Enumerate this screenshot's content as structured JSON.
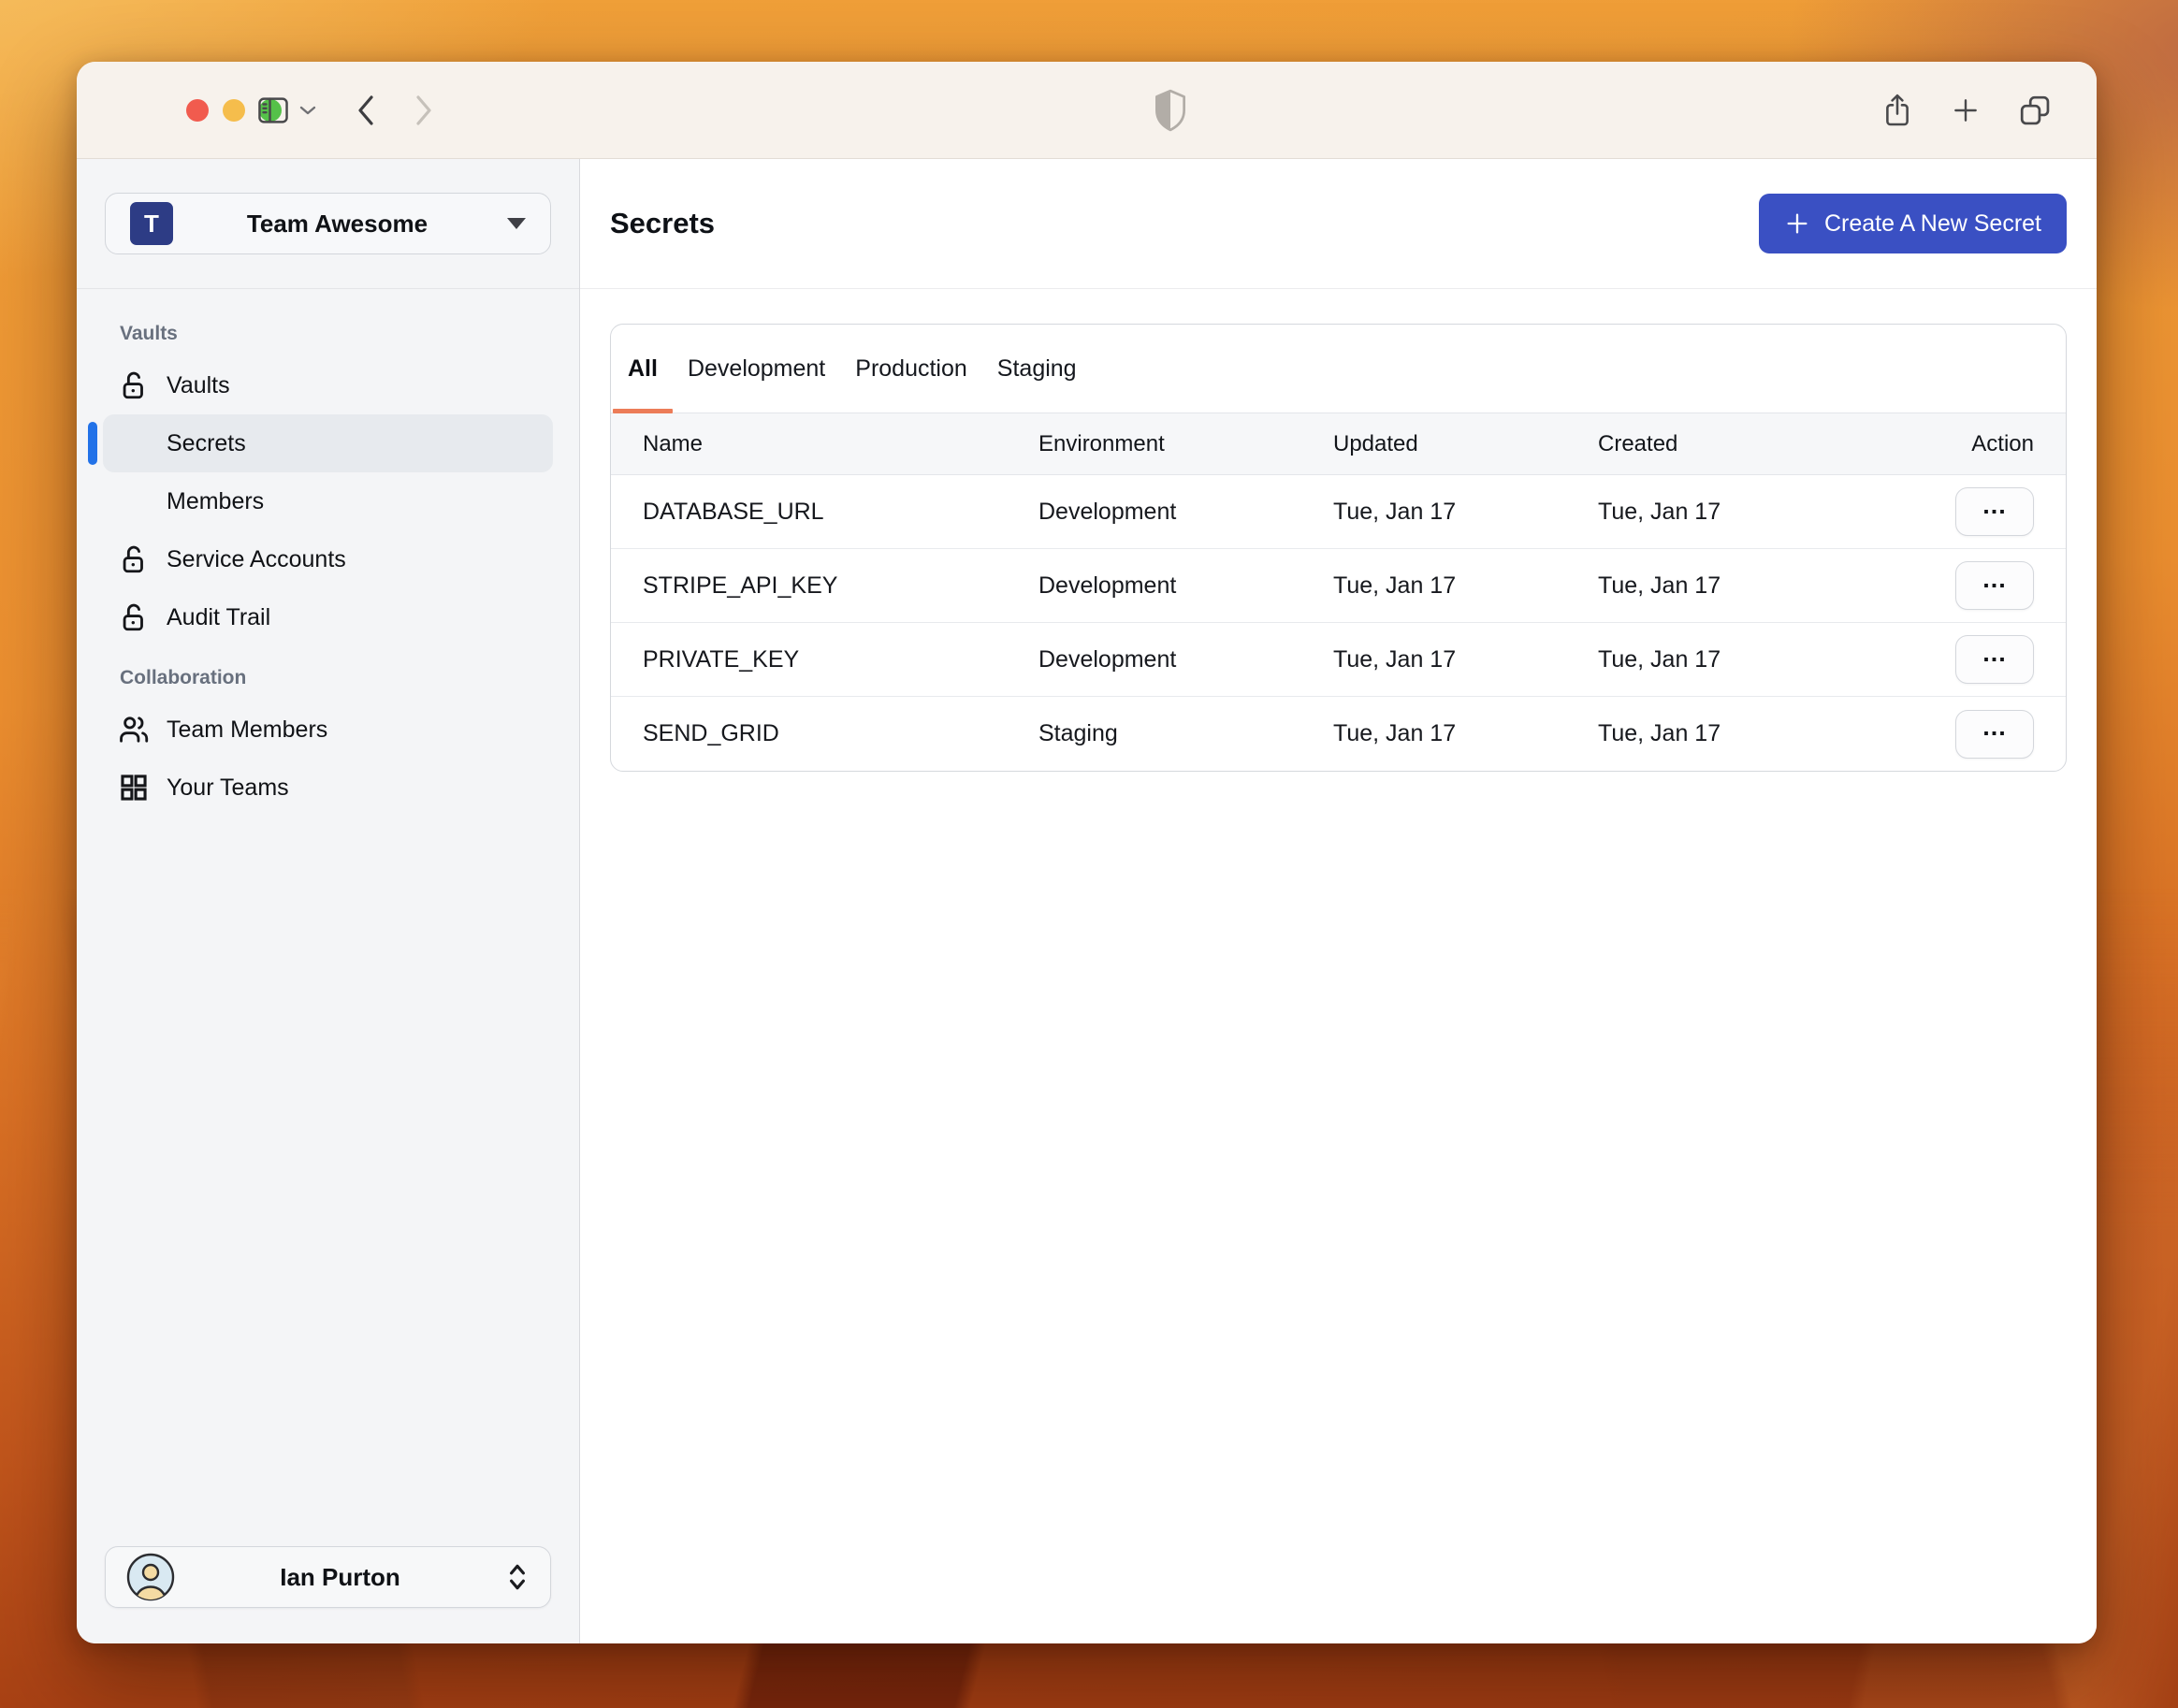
{
  "window": {
    "app": "secrets-vault-manager",
    "titlebar": {
      "traffic_lights": [
        "close",
        "minimize",
        "zoom"
      ],
      "left_icons": [
        "sidebar-toggle-icon",
        "chevron-down-icon",
        "back-icon",
        "forward-icon"
      ],
      "center_icon": "shield-icon",
      "right_icons": [
        "share-icon",
        "plus-icon",
        "copy-tabs-icon"
      ]
    }
  },
  "sidebar": {
    "team": {
      "initial": "T",
      "name": "Team Awesome"
    },
    "sections": [
      {
        "label": "Vaults",
        "items": [
          {
            "label": "Vaults",
            "icon": "unlock-icon"
          },
          {
            "label": "Secrets",
            "icon": null,
            "selected": true
          },
          {
            "label": "Members",
            "icon": null
          },
          {
            "label": "Service Accounts",
            "icon": "unlock-icon"
          },
          {
            "label": "Audit Trail",
            "icon": "unlock-icon"
          }
        ]
      },
      {
        "label": "Collaboration",
        "items": [
          {
            "label": "Team Members",
            "icon": "users-icon"
          },
          {
            "label": "Your Teams",
            "icon": "grid-icon"
          }
        ]
      }
    ],
    "user": {
      "name": "Ian Purton",
      "avatar": "person-circle-icon",
      "control": "chevron-up-down-icon"
    }
  },
  "main": {
    "title": "Secrets",
    "create_button": {
      "label": "Create A New Secret",
      "icon": "plus-icon"
    },
    "tabs": [
      {
        "label": "All",
        "active": true
      },
      {
        "label": "Development",
        "active": false
      },
      {
        "label": "Production",
        "active": false
      },
      {
        "label": "Staging",
        "active": false
      }
    ],
    "table": {
      "columns": [
        "Name",
        "Environment",
        "Updated",
        "Created",
        "Action"
      ],
      "action_label": "...",
      "rows": [
        {
          "name": "DATABASE_URL",
          "environment": "Development",
          "updated": "Tue, Jan 17",
          "created": "Tue, Jan 17"
        },
        {
          "name": "STRIPE_API_KEY",
          "environment": "Development",
          "updated": "Tue, Jan 17",
          "created": "Tue, Jan 17"
        },
        {
          "name": "PRIVATE_KEY",
          "environment": "Development",
          "updated": "Tue, Jan 17",
          "created": "Tue, Jan 17"
        },
        {
          "name": "SEND_GRID",
          "environment": "Staging",
          "updated": "Tue, Jan 17",
          "created": "Tue, Jan 17"
        }
      ]
    }
  },
  "colors": {
    "accent_button_blue": "#3a50c3",
    "selected_indicator_blue": "#2272e8",
    "active_tab_underline": "#ec7c58",
    "team_avatar_blue": "#2d3c85",
    "traffic_red": "#f15b4e",
    "traffic_yellow": "#f5bd4c",
    "traffic_green": "#55c149",
    "titlebar_bg": "#f7f2ec",
    "sidebar_bg": "#f4f5f7"
  }
}
